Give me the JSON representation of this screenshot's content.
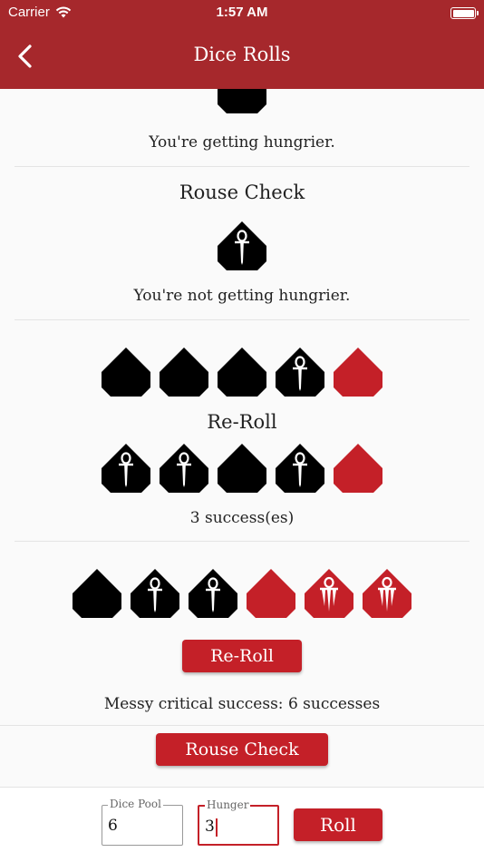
{
  "status_bar": {
    "carrier": "Carrier",
    "time": "1:57 AM"
  },
  "nav": {
    "title": "Dice Rolls"
  },
  "history": [
    {
      "result": "You're getting hungrier."
    },
    {
      "heading": "Rouse Check",
      "result": "You're not getting hungrier."
    },
    {
      "reroll_heading": "Re-Roll",
      "result": "3 success(es)"
    },
    {
      "reroll_button": "Re-Roll",
      "result": "Messy critical success: 6 successes"
    }
  ],
  "dice_rows": [
    {
      "dice": [
        {
          "color": "black",
          "face": "blank"
        }
      ],
      "partial": true
    },
    {
      "dice": [
        {
          "color": "black",
          "face": "ankh"
        }
      ]
    },
    {
      "dice": [
        {
          "color": "black",
          "face": "blank"
        },
        {
          "color": "black",
          "face": "blank"
        },
        {
          "color": "black",
          "face": "blank"
        },
        {
          "color": "black",
          "face": "ankh"
        },
        {
          "color": "red",
          "face": "blank"
        }
      ]
    },
    {
      "dice": [
        {
          "color": "black",
          "face": "ankh"
        },
        {
          "color": "black",
          "face": "ankh"
        },
        {
          "color": "black",
          "face": "blank"
        },
        {
          "color": "black",
          "face": "ankh"
        },
        {
          "color": "red",
          "face": "blank"
        }
      ]
    },
    {
      "dice": [
        {
          "color": "black",
          "face": "blank"
        },
        {
          "color": "black",
          "face": "ankh"
        },
        {
          "color": "black",
          "face": "ankh"
        },
        {
          "color": "red",
          "face": "blank"
        },
        {
          "color": "red",
          "face": "fang"
        },
        {
          "color": "red",
          "face": "fang"
        }
      ]
    }
  ],
  "rouse_check_button": "Rouse Check",
  "inputs": {
    "dice_pool": {
      "label": "Dice Pool",
      "value": "6"
    },
    "hunger": {
      "label": "Hunger",
      "value": "3"
    }
  },
  "roll_button": "Roll",
  "colors": {
    "accent": "#c42028",
    "navbar": "#a6282c",
    "die_black": "#000000",
    "die_red": "#c42028"
  }
}
